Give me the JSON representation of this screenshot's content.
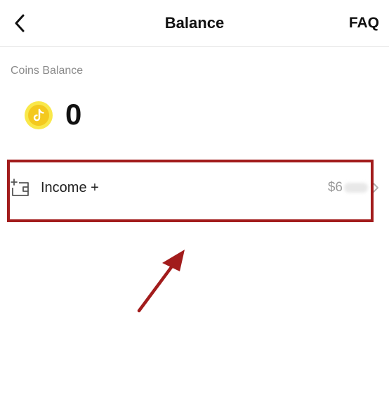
{
  "header": {
    "title": "Balance",
    "faq_label": "FAQ"
  },
  "balance": {
    "label": "Coins Balance",
    "coins": "0"
  },
  "income": {
    "label": "Income +",
    "amount_prefix": "$6"
  },
  "icons": {
    "back": "chevron-left-icon",
    "coin": "tiktok-coin-icon",
    "wallet": "wallet-plus-icon",
    "chevron": "chevron-right-icon"
  },
  "colors": {
    "accent_red": "#a21c1c",
    "coin_yellow": "#f4c91e",
    "muted_text": "#8a8a8a"
  }
}
